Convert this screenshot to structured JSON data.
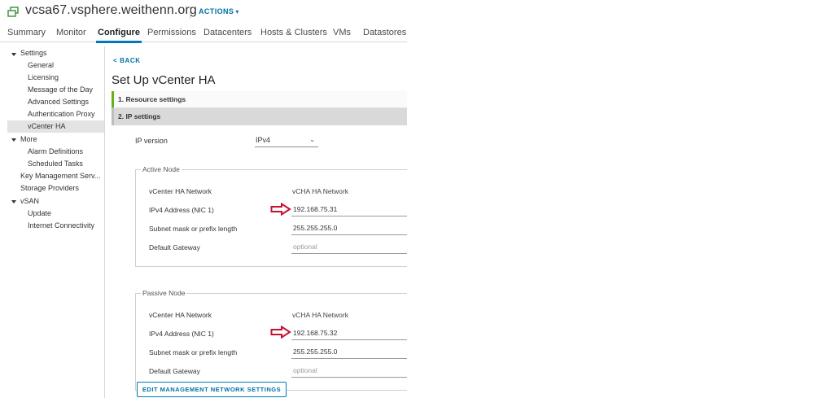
{
  "header": {
    "title": "vcsa67.vsphere.weithenn.org",
    "actions_label": "ACTIONS"
  },
  "tabs": [
    "Summary",
    "Monitor",
    "Configure",
    "Permissions",
    "Datacenters",
    "Hosts & Clusters",
    "VMs",
    "Datastores"
  ],
  "active_tab": "Configure",
  "sidebar": {
    "items": [
      {
        "label": "Settings"
      },
      {
        "label": "General"
      },
      {
        "label": "Licensing"
      },
      {
        "label": "Message of the Day"
      },
      {
        "label": "Advanced Settings"
      },
      {
        "label": "Authentication Proxy"
      },
      {
        "label": "vCenter HA"
      },
      {
        "label": "More"
      },
      {
        "label": "Alarm Definitions"
      },
      {
        "label": "Scheduled Tasks"
      },
      {
        "label": "Key Management Serv..."
      },
      {
        "label": "Storage Providers"
      },
      {
        "label": "vSAN"
      },
      {
        "label": "Update"
      },
      {
        "label": "Internet Connectivity"
      }
    ],
    "active_item": "vCenter HA"
  },
  "main": {
    "back_label": "BACK",
    "page_title": "Set Up vCenter HA",
    "steps": [
      "1. Resource settings",
      "2. IP settings"
    ],
    "ip_version_label": "IP version",
    "ip_version_value": "IPv4",
    "active_node": {
      "legend": "Active Node",
      "network_label": "vCenter HA Network",
      "network_value": "vCHA HA Network",
      "ipv4_label": "IPv4 Address (NIC 1)",
      "ipv4_value": "192.168.75.31",
      "subnet_label": "Subnet mask or prefix length",
      "subnet_value": "255.255.255.0",
      "gateway_label": "Default Gateway",
      "gateway_placeholder": "optional"
    },
    "passive_node": {
      "legend": "Passive Node",
      "network_label": "vCenter HA Network",
      "network_value": "vCHA HA Network",
      "ipv4_label": "IPv4 Address (NIC 1)",
      "ipv4_value": "192.168.75.32",
      "subnet_label": "Subnet mask or prefix length",
      "subnet_value": "255.255.255.0",
      "gateway_label": "Default Gateway",
      "gateway_placeholder": "optional"
    },
    "edit_button_label": "EDIT MANAGEMENT NETWORK SETTINGS"
  },
  "colors": {
    "accent": "#0079b8",
    "link": "#0072a3",
    "step_complete": "#60b515",
    "annotation_arrow": "#c8102e"
  },
  "icons": {
    "app": "vcenter-vms-icon",
    "annotation": "red-arrow-icon"
  }
}
